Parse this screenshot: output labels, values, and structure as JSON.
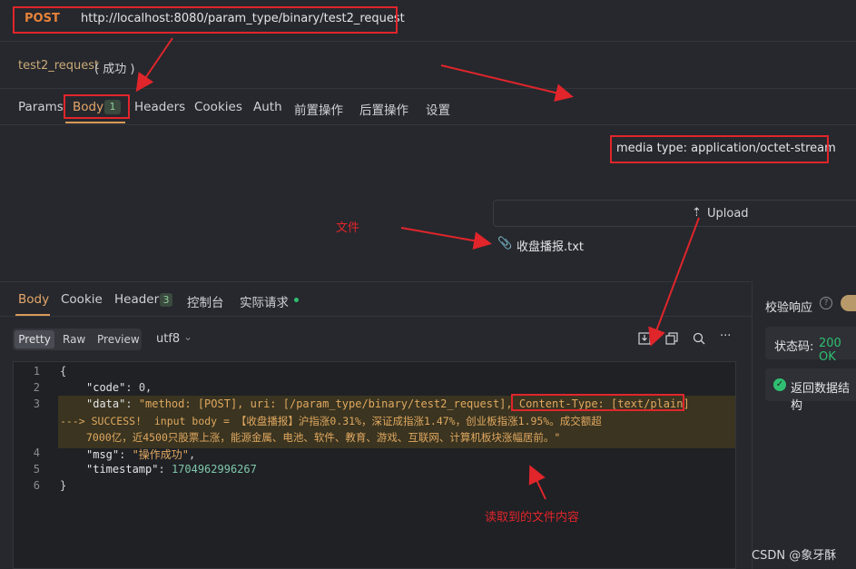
{
  "request": {
    "method": "POST",
    "url": "http://localhost:8080/param_type/binary/test2_request",
    "name": "test2_request",
    "status": "( 成功 )"
  },
  "request_tabs": [
    {
      "label": "Params"
    },
    {
      "label": "Body",
      "badge": "1"
    },
    {
      "label": "Headers"
    },
    {
      "label": "Cookies"
    },
    {
      "label": "Auth"
    },
    {
      "label": "前置操作"
    },
    {
      "label": "后置操作"
    },
    {
      "label": "设置"
    }
  ],
  "body": {
    "media_type": "media type: application/octet-stream",
    "upload_label": "Upload",
    "file_name": "收盘播报.txt"
  },
  "annotations": {
    "file_label": "文件",
    "read_label": "读取到的文件内容"
  },
  "response_tabs": [
    {
      "label": "Body"
    },
    {
      "label": "Cookie"
    },
    {
      "label": "Header",
      "badge": "3"
    },
    {
      "label": "控制台"
    },
    {
      "label": "实际请求"
    }
  ],
  "view_modes": [
    "Pretty",
    "Raw",
    "Preview"
  ],
  "encoding": "utf8",
  "code": {
    "line_numbers": [
      "1",
      "2",
      "3",
      "4",
      "5",
      "6"
    ],
    "open_brace": "{",
    "close_brace": "}",
    "code_key": "\"code\"",
    "code_value": "0",
    "data_key": "\"data\"",
    "data_part1": "\"method: [POST], uri: [/param_type/binary/test2_request], ",
    "data_content_type": "Content-Type: [text/plain]",
    "data_part2": "---> SUCCESS!  input body = 【收盘播报】沪指涨0.31%，深证成指涨1.47%，创业板指涨1.95%。成交额超",
    "data_part3": "7000亿，近4500只股票上涨，能源金属、电池、软件、教育、游戏、互联网、计算机板块涨幅居前。\"",
    "msg_key": "\"msg\"",
    "msg_value": "\"操作成功\"",
    "timestamp_key": "\"timestamp\"",
    "timestamp_value": "1704962996267"
  },
  "side": {
    "title": "校验响应",
    "status_label": "状态码:",
    "status_value": "200 OK",
    "check_label": "返回数据结构"
  },
  "watermark": "CSDN @象牙酥",
  "colors": {
    "annotation_red": "#e0252b",
    "accent_orange": "#e6a66a",
    "success_green": "#2fbf71"
  }
}
